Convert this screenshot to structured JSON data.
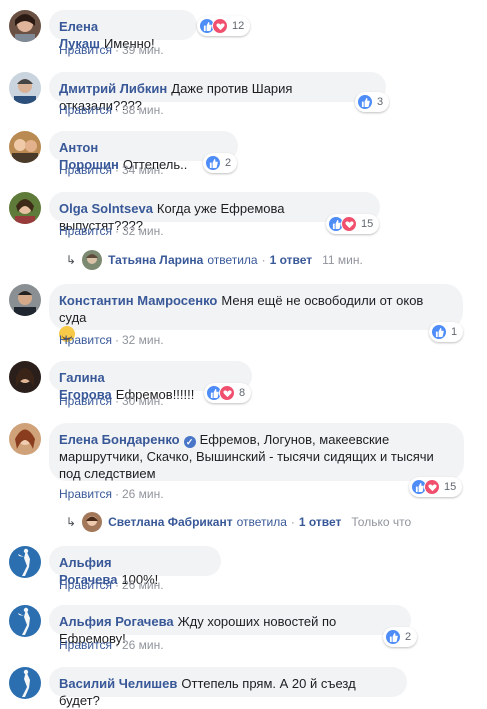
{
  "like_label": "Нравится",
  "separator": "·",
  "comments": [
    {
      "author": "Елена Лукаш",
      "text": "Именно!",
      "time": "39 мин.",
      "reactions": {
        "count": "12",
        "types": [
          "like-icon",
          "love-icon"
        ]
      }
    },
    {
      "author": "Дмитрий Либкин",
      "text": "Даже против Шария отказали????",
      "time": "38 мин.",
      "reactions": {
        "count": "3",
        "types": [
          "like-icon"
        ]
      }
    },
    {
      "author": "Антон Порошин",
      "text": "Оттепель..",
      "time": "34 мин.",
      "reactions": {
        "count": "2",
        "types": [
          "like-icon"
        ]
      }
    },
    {
      "author": "Olga Solntseva",
      "text": "Когда уже Ефремова выпустят????",
      "time": "32 мин.",
      "reactions": {
        "count": "15",
        "types": [
          "like-icon",
          "love-icon"
        ]
      },
      "reply": {
        "name": "Татьяна Ларина",
        "verb": "ответила",
        "count": "1 ответ",
        "time": "11 мин."
      }
    },
    {
      "author": "Константин Мамросенко",
      "text": "Меня ещё не освободили от оков суда",
      "emoji": "grinning-face-emoji",
      "time": "32 мин.",
      "reactions": {
        "count": "1",
        "types": [
          "like-icon"
        ]
      }
    },
    {
      "author": "Галина Егорова",
      "text": "Ефремов!!!!!!",
      "time": "30 мин.",
      "reactions": {
        "count": "8",
        "types": [
          "like-icon",
          "love-icon"
        ]
      }
    },
    {
      "author": "Елена Бондаренко",
      "verified": true,
      "text_lines": [
        "Ефремов, Логунов, макеевские",
        "маршрутчики, Скачко, Вышинский - тысячи сидящих и тысячи",
        "под следствием"
      ],
      "time": "26 мин.",
      "reactions": {
        "count": "15",
        "types": [
          "like-icon",
          "love-icon"
        ]
      },
      "reply": {
        "name": "Светлана Фабрикант",
        "verb": "ответила",
        "count": "1 ответ",
        "time": "Только что"
      }
    },
    {
      "author": "Альфия Рогачева",
      "text": "100%!",
      "time": "26 мин."
    },
    {
      "author": "Альфия Рогачева",
      "text": "Жду хороших новостей по Ефремову!",
      "time": "26 мин.",
      "reactions": {
        "count": "2",
        "types": [
          "like-icon"
        ]
      }
    },
    {
      "author": "Василий Челишев",
      "text": "Оттепель прям. А 20 й съезд будет?"
    }
  ]
}
